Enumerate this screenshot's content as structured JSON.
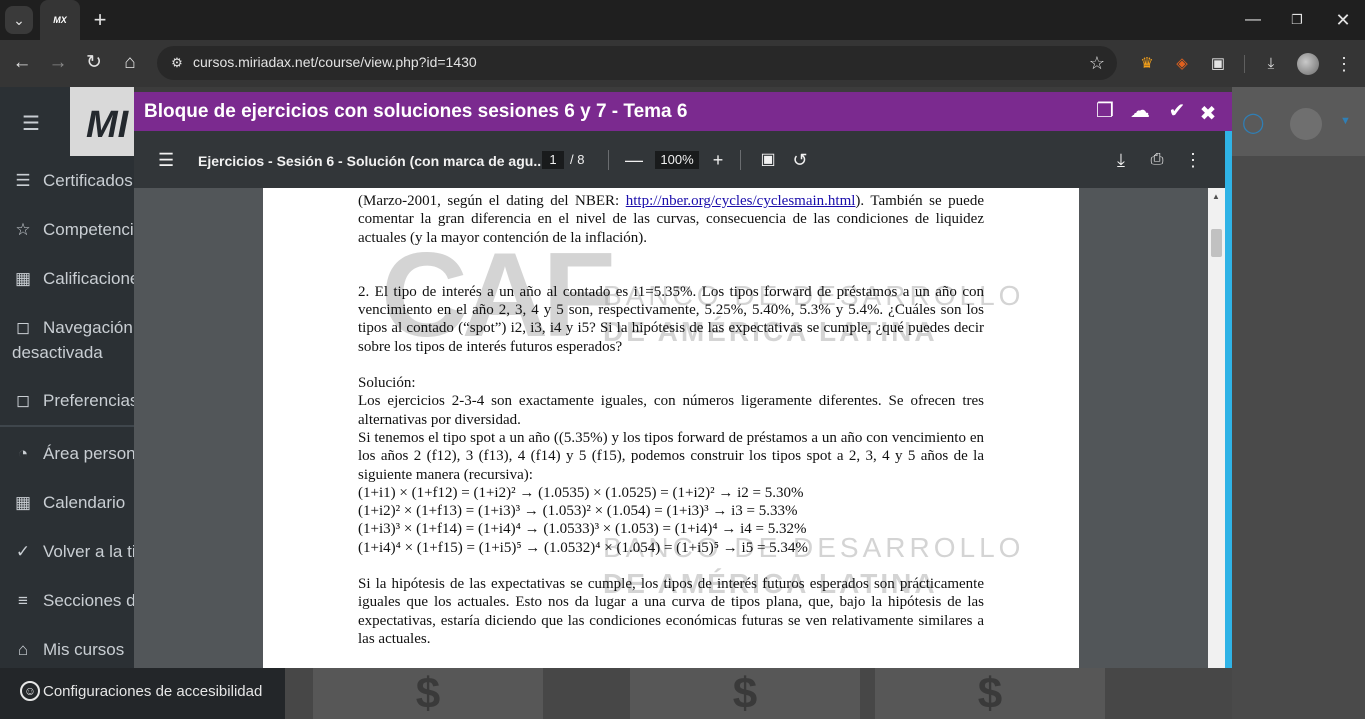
{
  "browser": {
    "tab": {
      "favicon_text": "MX"
    },
    "address": {
      "domain": "cursos.miriadax.net",
      "path": "/course/view.php?id=1430"
    }
  },
  "site": {
    "logo_text": "MI",
    "sidebar": [
      {
        "icon": "layers-icon",
        "label": "Certificados"
      },
      {
        "icon": "star-icon",
        "label": "Competencias"
      },
      {
        "icon": "table-icon",
        "label": "Calificaciones"
      },
      {
        "icon": "folder-icon",
        "label": "Navegación",
        "label2": "desactivada"
      },
      {
        "icon": "folder-icon",
        "label": "Preferencias"
      },
      {
        "icon": "gauge-icon",
        "label": "Área personal"
      },
      {
        "icon": "calendar-icon",
        "label": "Calendario"
      },
      {
        "icon": "cart-icon",
        "label": "Volver a la tienda"
      },
      {
        "icon": "list-icon",
        "label": "Secciones del curso"
      },
      {
        "icon": "home-icon",
        "label": "Mis cursos"
      }
    ],
    "accessibility_label": "Configuraciones de accesibilidad",
    "card_symbol": "$"
  },
  "modal": {
    "title": "Bloque de ejercicios con soluciones sesiones 6 y 7 - Tema 6",
    "accent_color": "#7b2a8f"
  },
  "pdf": {
    "filename": "Ejercicios - Sesión 6 - Solución (con marca de agu...",
    "page_current": "1",
    "page_total": "/ 8",
    "zoom": "100%",
    "watermark": {
      "logo": "CAF",
      "line1": "BANCO DE DESARROLLO",
      "line2": "DE AMÉRICA LATINA"
    },
    "content": {
      "p0_a": "(Marzo-2001, según el dating del NBER: ",
      "p0_link": "http://nber.org/cycles/cyclesmain.html",
      "p0_b": "). También se puede comentar la gran diferencia en el nivel de las curvas, consecuencia de las condiciones de liquidez actuales (y la mayor contención de la inflación).",
      "q2": "2. El tipo de interés a un año al contado es i1=5.35%. Los tipos forward de préstamos a un año con vencimiento en el año 2, 3, 4 y 5 son, respectivamente, 5.25%, 5.40%, 5.3% y 5.4%. ¿Cuáles son los tipos al contado (“spot”) i2, i3, i4 y i5? Si la hipótesis de las expectativas se cumple, ¿qué puedes decir sobre los tipos de interés futuros esperados?",
      "sol_heading": "Solución:",
      "sol_p1": "Los ejercicios 2-3-4 son exactamente iguales, con números ligeramente diferentes. Se ofrecen tres alternativas por diversidad.",
      "sol_p2": "Si tenemos el tipo spot a un año ((5.35%) y los tipos forward de préstamos a un año con vencimiento en los años 2 (f12), 3 (f13), 4 (f14) y 5 (f15), podemos construir los tipos spot a 2, 3, 4 y 5 años de la siguiente manera (recursiva):",
      "eq1": "(1+i1) × (1+f12) = (1+i2)² → (1.0535) × (1.0525) = (1+i2)² → i2 = 5.30%",
      "eq2": "(1+i2)² × (1+f13) = (1+i3)³ → (1.053)² × (1.054) = (1+i3)³ → i3 = 5.33%",
      "eq3": "(1+i3)³ × (1+f14) = (1+i4)⁴ → (1.0533)³ × (1.053) = (1+i4)⁴ → i4 = 5.32%",
      "eq4": "(1+i4)⁴ × (1+f15) = (1+i5)⁵ → (1.0532)⁴ × (1.054) = (1+i5)⁵ → i5 = 5.34%",
      "conclusion": "Si la hipótesis de las expectativas se cumple, los tipos de interés futuros esperados son prácticamente iguales que los actuales. Esto nos da lugar a una curva de tipos plana, que, bajo la hipótesis de las expectativas, estaría diciendo que las condiciones económicas futuras se ven relativamente similares a las actuales."
    }
  }
}
